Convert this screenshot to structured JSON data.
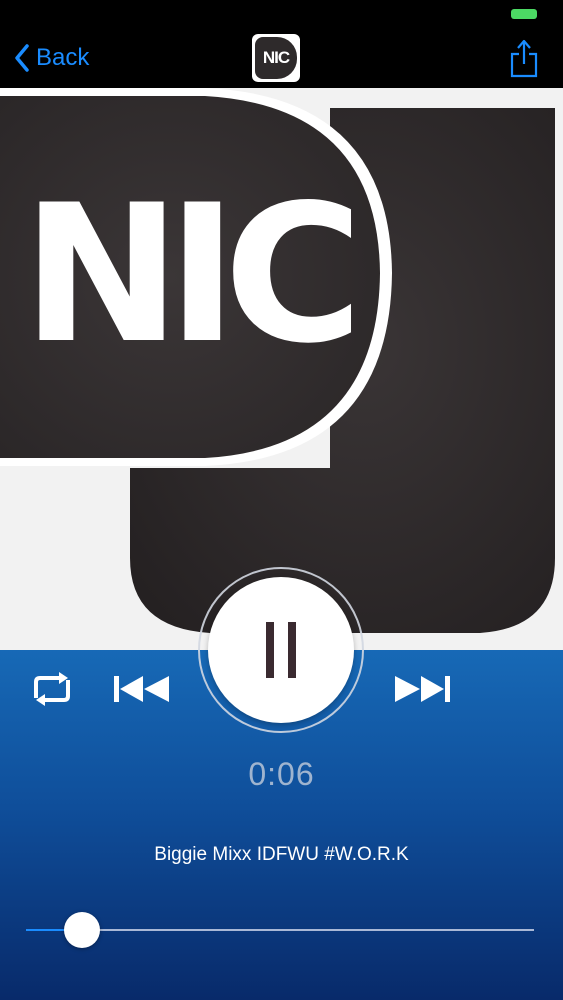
{
  "nav": {
    "back_label": "Back",
    "logo_text": "NIC",
    "back_icon": "chevron-left-icon",
    "share_icon": "share-icon"
  },
  "artwork": {
    "logo_text": "NIC"
  },
  "player": {
    "elapsed": "0:06",
    "track_title": "Biggie Mixx IDFWU #W.O.R.K",
    "progress": 0.06,
    "state": "playing"
  },
  "colors": {
    "accent": "#1a8cff",
    "battery": "#4cd964",
    "panel_top": "#1769b6",
    "panel_bottom": "#082a6a",
    "logo_dark": "#2e2a2b"
  }
}
